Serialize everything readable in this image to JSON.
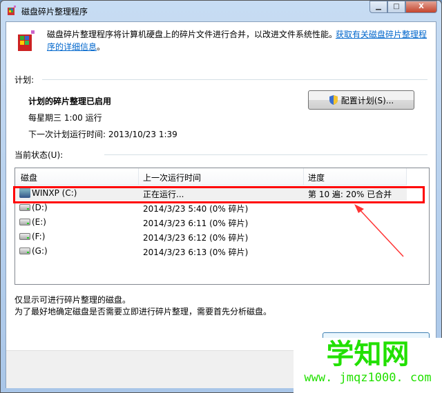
{
  "window": {
    "title": "磁盘碎片整理程序",
    "minimize": "▁",
    "maximize": "□",
    "close": "X"
  },
  "intro": {
    "text": "磁盘碎片整理程序将计算机硬盘上的碎片文件进行合并，以改进文件系统性能。",
    "link_part1": "获取有关磁盘碎片整理程",
    "link_part2": "序的详细信息",
    "suffix": "。"
  },
  "schedule": {
    "heading": "计划:",
    "status": "计划的碎片整理已启用",
    "frequency": "每星期三  1:00 运行",
    "next_run": "下一次计划运行时间: 2013/10/23 1:39",
    "configure_button": "配置计划(S)..."
  },
  "current": {
    "heading": "当前状态(U):",
    "columns": [
      "磁盘",
      "上一次运行时间",
      "进度"
    ],
    "rows": [
      {
        "disk": "WINXP (C:)",
        "last_run": "正在运行...",
        "progress": "第 10 遍: 20% 已合并"
      },
      {
        "disk": "(D:)",
        "last_run": "2014/3/23 5:40 (0% 碎片)",
        "progress": ""
      },
      {
        "disk": "(E:)",
        "last_run": "2014/3/23 6:11 (0% 碎片)",
        "progress": ""
      },
      {
        "disk": "(F:)",
        "last_run": "2014/3/23 6:12 (0% 碎片)",
        "progress": ""
      },
      {
        "disk": "(G:)",
        "last_run": "2014/3/23 6:13 (0% 碎片)",
        "progress": ""
      }
    ]
  },
  "notes": [
    "仅显示可进行碎片整理的磁盘。",
    "为了最好地确定磁盘是否需要立即进行碎片整理，需要首先分析磁盘。"
  ],
  "watermark": {
    "title": "学知网",
    "url": "www. jmqz1000. com"
  },
  "colors": {
    "highlight": "#ff0000",
    "link": "#0066cc",
    "watermark": "#22e000"
  }
}
